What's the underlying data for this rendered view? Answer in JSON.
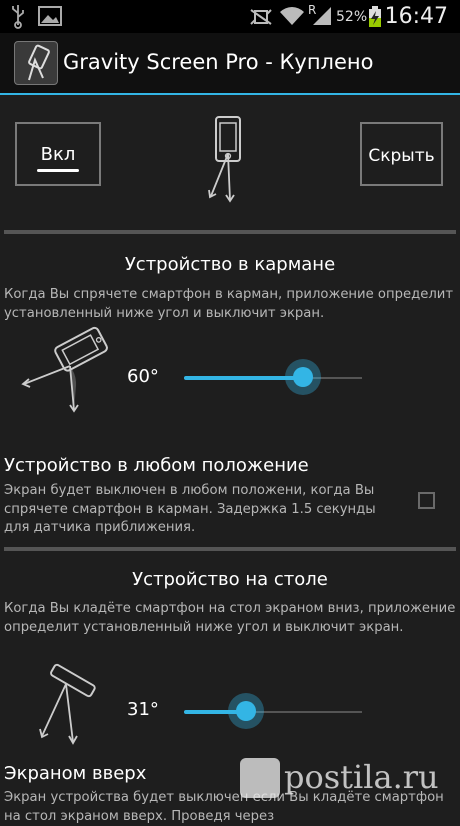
{
  "statusbar": {
    "signal_letter": "R",
    "battery": "52%",
    "time": "16:47",
    "icons": [
      "usb-icon",
      "image-icon",
      "mute-icon",
      "wifi-icon",
      "signal-icon",
      "battery-charging-icon"
    ]
  },
  "header": {
    "title": "Gravity Screen Pro - Куплено"
  },
  "top_controls": {
    "on_label": "Вкл",
    "hide_label": "Скрыть"
  },
  "pocket": {
    "title": "Устройство в кармане",
    "description": "Когда Вы спрячете смартфон в карман, приложение определит установленный ниже угол и выключит экран.",
    "angle_label": "60°",
    "slider_fraction": 0.67
  },
  "any_position": {
    "title": "Устройство в любом положение",
    "description": "Экран будет выключен в любом положени, когда Вы спрячете смартфон в карман. Задержка 1.5 секунды для датчика приближения.",
    "checked": false
  },
  "table": {
    "title": "Устройство на столе",
    "description": "Когда Вы кладёте смартфон на стол экраном вниз, приложение определит установленный ниже угол и выключит экран.",
    "angle_label": "31°",
    "slider_fraction": 0.34
  },
  "face_up": {
    "title": "Экраном вверх",
    "description": "Экран устройства будет выключен если Вы кладёте смартфон на стол экраном вверх. Проведя через"
  },
  "watermark": "postila.ru",
  "colors": {
    "accent": "#33b5e5",
    "background": "#1e1e1e"
  }
}
